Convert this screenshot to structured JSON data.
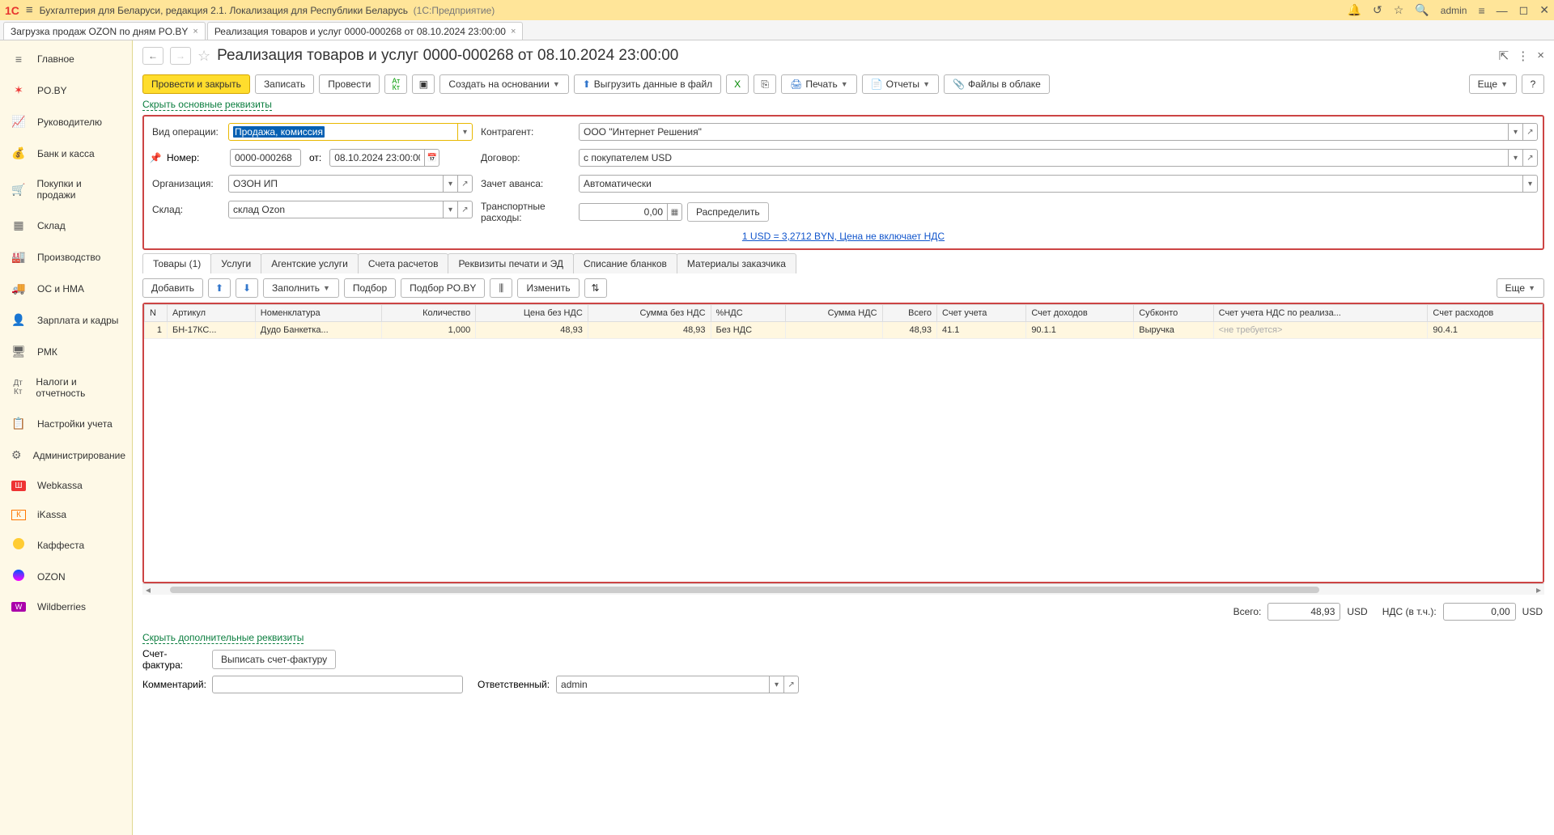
{
  "app": {
    "title": "Бухгалтерия для Беларуси, редакция 2.1. Локализация для Республики Беларусь",
    "platform": "(1С:Предприятие)",
    "user": "admin"
  },
  "tabs": [
    {
      "label": "Загрузка продаж OZON по дням PO.BY"
    },
    {
      "label": "Реализация товаров и услуг 0000-000268 от 08.10.2024 23:00:00"
    }
  ],
  "sidebar": [
    {
      "label": "Главное",
      "icon": "home"
    },
    {
      "label": "PO.BY",
      "icon": "poby"
    },
    {
      "label": "Руководителю",
      "icon": "chart"
    },
    {
      "label": "Банк и касса",
      "icon": "bank"
    },
    {
      "label": "Покупки и продажи",
      "icon": "cart"
    },
    {
      "label": "Склад",
      "icon": "warehouse"
    },
    {
      "label": "Производство",
      "icon": "prod"
    },
    {
      "label": "ОС и НМА",
      "icon": "truck"
    },
    {
      "label": "Зарплата и кадры",
      "icon": "people"
    },
    {
      "label": "РМК",
      "icon": "rmk"
    },
    {
      "label": "Налоги и отчетность",
      "icon": "tax"
    },
    {
      "label": "Настройки учета",
      "icon": "settings"
    },
    {
      "label": "Администрирование",
      "icon": "gear"
    },
    {
      "label": "Webkassa",
      "icon": "wk"
    },
    {
      "label": "iKassa",
      "icon": "ik"
    },
    {
      "label": "Каффеста",
      "icon": "kf"
    },
    {
      "label": "OZON",
      "icon": "oz"
    },
    {
      "label": "Wildberries",
      "icon": "wb"
    }
  ],
  "page": {
    "title": "Реализация товаров и услуг 0000-000268 от 08.10.2024 23:00:00",
    "hide_link": "Скрыть основные реквизиты",
    "hide_link2": "Скрыть дополнительные реквизиты"
  },
  "toolbar": {
    "post_close": "Провести и закрыть",
    "save": "Записать",
    "post": "Провести",
    "create_based": "Создать на основании",
    "export": "Выгрузить данные в файл",
    "print": "Печать",
    "reports": "Отчеты",
    "files": "Файлы в облаке",
    "more": "Еще"
  },
  "form": {
    "op_type_label": "Вид операции:",
    "op_type_value": "Продажа, комиссия",
    "counterparty_label": "Контрагент:",
    "counterparty_value": "ООО \"Интернет Решения\"",
    "number_label": "Номер:",
    "number_value": "0000-000268",
    "date_from": "от:",
    "date_value": "08.10.2024 23:00:00",
    "contract_label": "Договор:",
    "contract_value": "с покупателем USD",
    "org_label": "Организация:",
    "org_value": "ОЗОН ИП",
    "advance_label": "Зачет аванса:",
    "advance_value": "Автоматически",
    "warehouse_label": "Склад:",
    "warehouse_value": "склад Ozon",
    "transport_label": "Транспортные расходы:",
    "transport_value": "0,00",
    "distribute": "Распределить",
    "rate": "1 USD = 3,2712 BYN, Цена не включает НДС"
  },
  "tabs2": [
    "Товары (1)",
    "Услуги",
    "Агентские услуги",
    "Счета расчетов",
    "Реквизиты печати и ЭД",
    "Списание бланков",
    "Материалы заказчика"
  ],
  "subtoolbar": {
    "add": "Добавить",
    "fill": "Заполнить",
    "select": "Подбор",
    "select_poby": "Подбор PO.BY",
    "change": "Изменить",
    "more": "Еще"
  },
  "table": {
    "headers": [
      "N",
      "Артикул",
      "Номенклатура",
      "Количество",
      "Цена без НДС",
      "Сумма без НДС",
      "%НДС",
      "Сумма НДС",
      "Всего",
      "Счет учета",
      "Счет доходов",
      "Субконто",
      "Счет учета НДС по реализа...",
      "Счет расходов"
    ],
    "row": {
      "n": "1",
      "art": "БН-17КС...",
      "nom": "Дудо Банкетка...",
      "qty": "1,000",
      "price": "48,93",
      "sum": "48,93",
      "vat": "Без НДС",
      "sumvat": "",
      "total": "48,93",
      "acc": "41.1",
      "inc": "90.1.1",
      "sub": "Выручка",
      "vatacc": "<не требуется>",
      "exp": "90.4.1"
    }
  },
  "totals": {
    "total_label": "Всего:",
    "total": "48,93",
    "cur1": "USD",
    "vat_label": "НДС (в т.ч.):",
    "vat": "0,00",
    "cur2": "USD"
  },
  "bottom": {
    "invoice_label": "Счет-фактура:",
    "invoice_btn": "Выписать счет-фактуру",
    "comment_label": "Комментарий:",
    "resp_label": "Ответственный:",
    "resp_value": "admin"
  }
}
